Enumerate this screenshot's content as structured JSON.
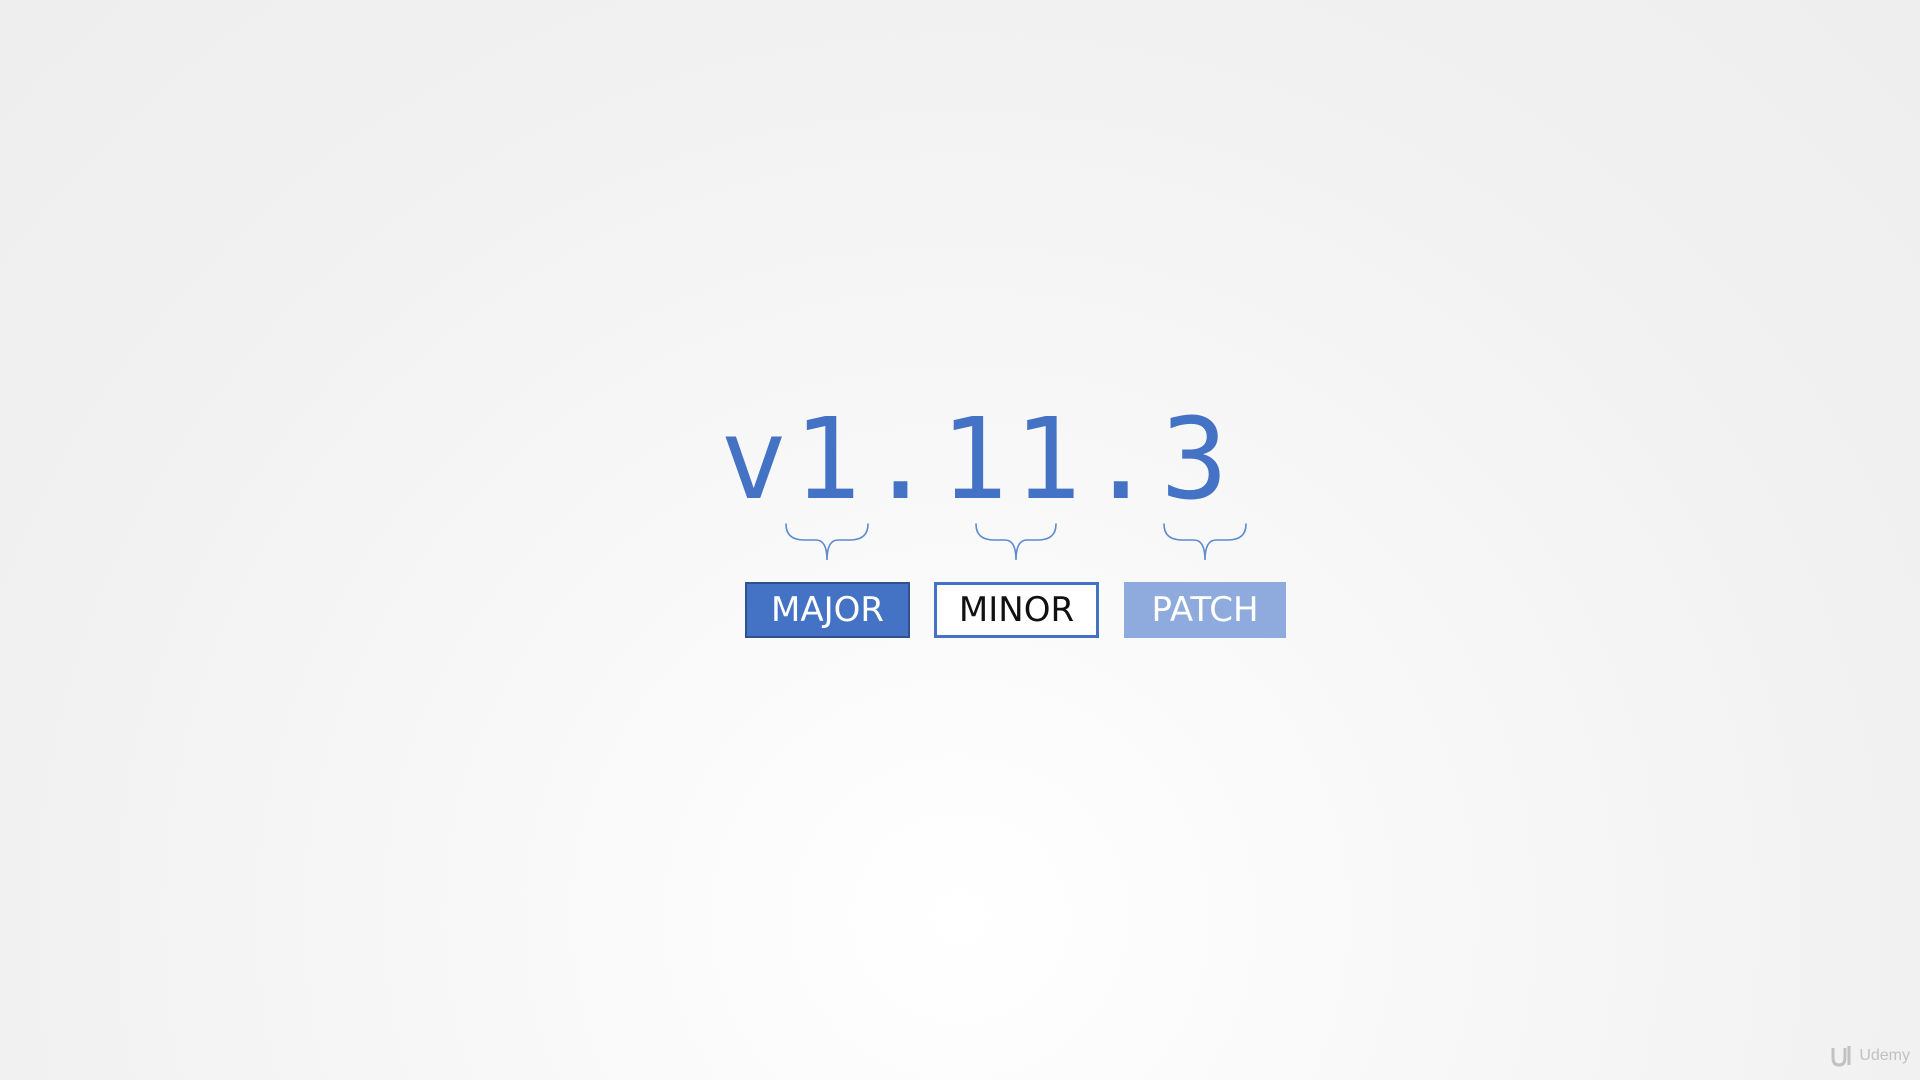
{
  "version": {
    "text": "v1.11.3",
    "parts": {
      "prefix": "v",
      "major": "1",
      "minor": "11",
      "patch": "3"
    }
  },
  "labels": {
    "major": "MAJOR",
    "minor": "MINOR",
    "patch": "PATCH"
  },
  "colors": {
    "primary": "#4472c4",
    "major_fill": "#4472c4",
    "minor_fill": "#ffffff",
    "patch_fill": "#8faadc",
    "brace_stroke": "#5b8bd0"
  },
  "watermark": {
    "icon": "udemy-logo-icon",
    "text": "Udemy"
  }
}
